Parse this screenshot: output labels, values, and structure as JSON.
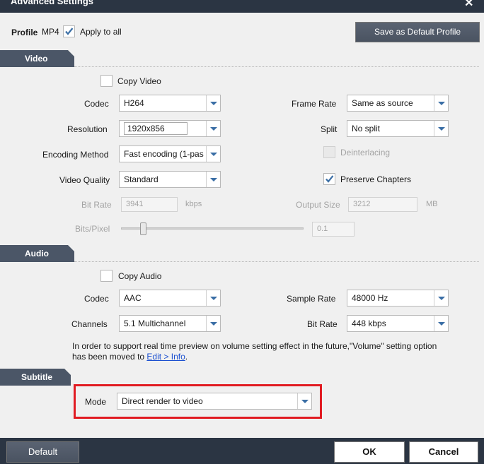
{
  "window": {
    "title": "Advanced Settings",
    "close_icon": "close-icon"
  },
  "profile": {
    "label": "Profile",
    "value": "MP4",
    "apply_all_label": "Apply to all",
    "apply_all_checked": true,
    "save_default_label": "Save as Default Profile"
  },
  "video": {
    "section_label": "Video",
    "copy_video_label": "Copy Video",
    "codec_label": "Codec",
    "codec_value": "H264",
    "resolution_label": "Resolution",
    "resolution_value": "1920x856",
    "encoding_label": "Encoding Method",
    "encoding_value": "Fast encoding (1-pas",
    "quality_label": "Video Quality",
    "quality_value": "Standard",
    "bitrate_label": "Bit Rate",
    "bitrate_value": "3941",
    "bitrate_unit": "kbps",
    "bits_pixel_label": "Bits/Pixel",
    "bits_pixel_value": "0.1",
    "bits_pixel_level": 0.12,
    "framerate_label": "Frame Rate",
    "framerate_value": "Same as source",
    "split_label": "Split",
    "split_value": "No split",
    "deinterlacing_label": "Deinterlacing",
    "preserve_label": "Preserve Chapters",
    "preserve_checked": true,
    "output_size_label": "Output Size",
    "output_size_value": "3212",
    "output_size_unit": "MB"
  },
  "audio": {
    "section_label": "Audio",
    "copy_audio_label": "Copy Audio",
    "codec_label": "Codec",
    "codec_value": "AAC",
    "channels_label": "Channels",
    "channels_value": "5.1 Multichannel",
    "sample_rate_label": "Sample Rate",
    "sample_rate_value": "48000 Hz",
    "bitrate_label": "Bit Rate",
    "bitrate_value": "448 kbps",
    "note_line1": "In order to support real time preview on volume setting effect in the future,\"Volume\" setting option",
    "note_line2_prefix": "has been moved to ",
    "note_link": "Edit > Info",
    "note_suffix": "."
  },
  "subtitle": {
    "section_label": "Subtitle",
    "mode_label": "Mode",
    "mode_value": "Direct render to video"
  },
  "footer": {
    "default_label": "Default",
    "ok_label": "OK",
    "cancel_label": "Cancel"
  },
  "colors": {
    "header": "#2b3543",
    "section_tab": "#4b5667",
    "highlight": "#e11b22",
    "check": "#3a6ea5"
  }
}
